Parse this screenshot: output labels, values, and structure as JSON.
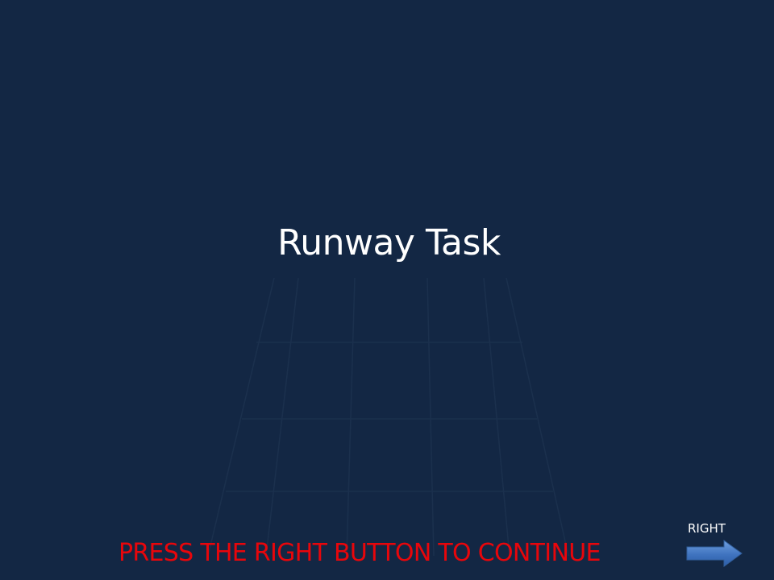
{
  "slide": {
    "title": "Runway Task",
    "instruction": "PRESS THE RIGHT BUTTON TO CONTINUE",
    "right_label": "RIGHT"
  },
  "colors": {
    "background": "#132744",
    "title_text": "#ffffff",
    "instruction_text": "#e8060b",
    "arrow_fill": "#4a7fc7"
  },
  "icons": {
    "next": "right-arrow-icon",
    "background": "runway-lines"
  }
}
